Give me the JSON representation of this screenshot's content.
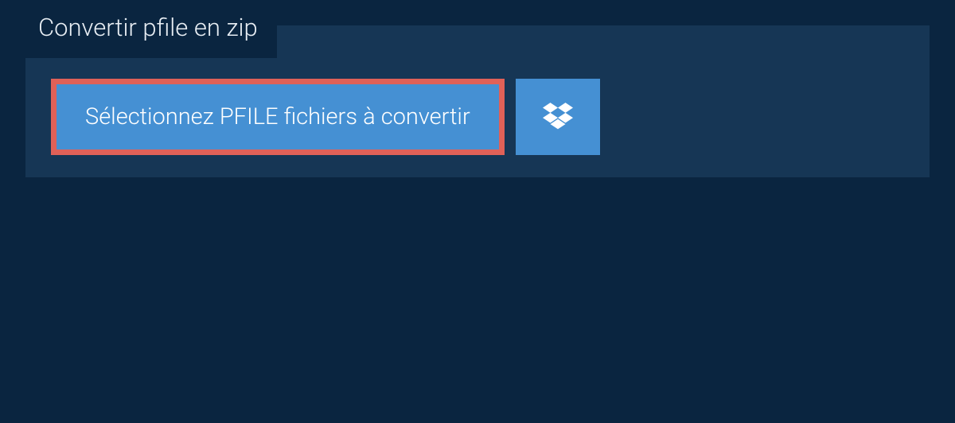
{
  "tab": {
    "label": "Convertir pfile en zip"
  },
  "upload": {
    "select_button_label": "Sélectionnez PFILE fichiers à convertir"
  }
}
